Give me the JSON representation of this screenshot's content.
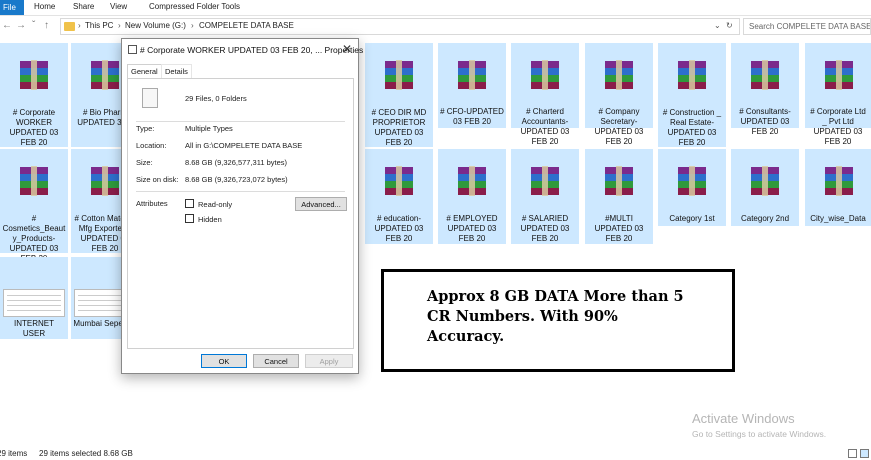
{
  "ribbon": {
    "tabs": [
      {
        "label": "File"
      },
      {
        "label": "Home"
      },
      {
        "label": "Share"
      },
      {
        "label": "View"
      },
      {
        "label": "Compressed Folder Tools"
      }
    ]
  },
  "address": {
    "crumbs": [
      "This PC",
      "New Volume (G:)",
      "COMPELETE DATA BASE"
    ],
    "search_placeholder": "Search COMPELETE DATA BASE"
  },
  "files": [
    {
      "name": "# Corporate WORKER UPDATED 03 FEB 20"
    },
    {
      "name": "# Bio Pharm UPDATED 3 20"
    },
    {
      "name": "# CEO DIR MD PROPRIETOR UPDATED 03 FEB 20"
    },
    {
      "name": "# CFO-UPDATED 03 FEB 20"
    },
    {
      "name": "# Charterd Accountants-UPDATED 03 FEB 20"
    },
    {
      "name": "# Company Secretary-UPDATED 03 FEB 20"
    },
    {
      "name": "# Construction _ Real Estate-UPDATED 03 FEB 20"
    },
    {
      "name": "# Consultants-UPDATED 03 FEB 20"
    },
    {
      "name": "# Corporate Ltd _ Pvt Ltd UPDATED 03 FEB 20"
    },
    {
      "name": "# Cosmetics_Beauty_Products-UPDATED 03 FEB 20"
    },
    {
      "name": "# Cotton Material Mfg Exporters-UPDATED 03 FEB 20"
    },
    {
      "name": "# education-UPDATED 03 FEB 20"
    },
    {
      "name": "# EMPLOYED UPDATED 03 FEB 20"
    },
    {
      "name": "# SALARIED UPDATED 03 FEB 20"
    },
    {
      "name": "#MULTI UPDATED 03 FEB 20"
    },
    {
      "name": "Category 1st"
    },
    {
      "name": "Category 2nd"
    },
    {
      "name": "City_wise_Data"
    },
    {
      "name": "INTERNET USER"
    },
    {
      "name": "Mumbai Seperate"
    }
  ],
  "dialog": {
    "title": "# Corporate WORKER UPDATED 03 FEB 20, ... Properties",
    "close_label": "✕",
    "tabs": [
      "General",
      "Details"
    ],
    "summary": "29 Files, 0 Folders",
    "props": [
      {
        "key": "Type:",
        "value": "Multiple Types"
      },
      {
        "key": "Location:",
        "value": "All in G:\\COMPELETE DATA BASE"
      },
      {
        "key": "Size:",
        "value": "8.68 GB (9,326,577,311 bytes)"
      },
      {
        "key": "Size on disk:",
        "value": "8.68 GB (9,326,723,072 bytes)"
      }
    ],
    "attributes_label": "Attributes",
    "readonly_label": "Read-only",
    "hidden_label": "Hidden",
    "advanced_label": "Advanced...",
    "ok_label": "OK",
    "cancel_label": "Cancel",
    "apply_label": "Apply"
  },
  "promo": {
    "text": "Approx 8 GB DATA More than 5 CR Numbers. With 90% Accuracy."
  },
  "watermark": {
    "line1": "Activate Windows",
    "line2": "Go to Settings to activate Windows."
  },
  "status": {
    "items_count": "29 items",
    "selected": "29 items selected  8.68 GB"
  },
  "colors": {
    "selection": "#cde8ff",
    "file_tab": "#1979ca"
  }
}
